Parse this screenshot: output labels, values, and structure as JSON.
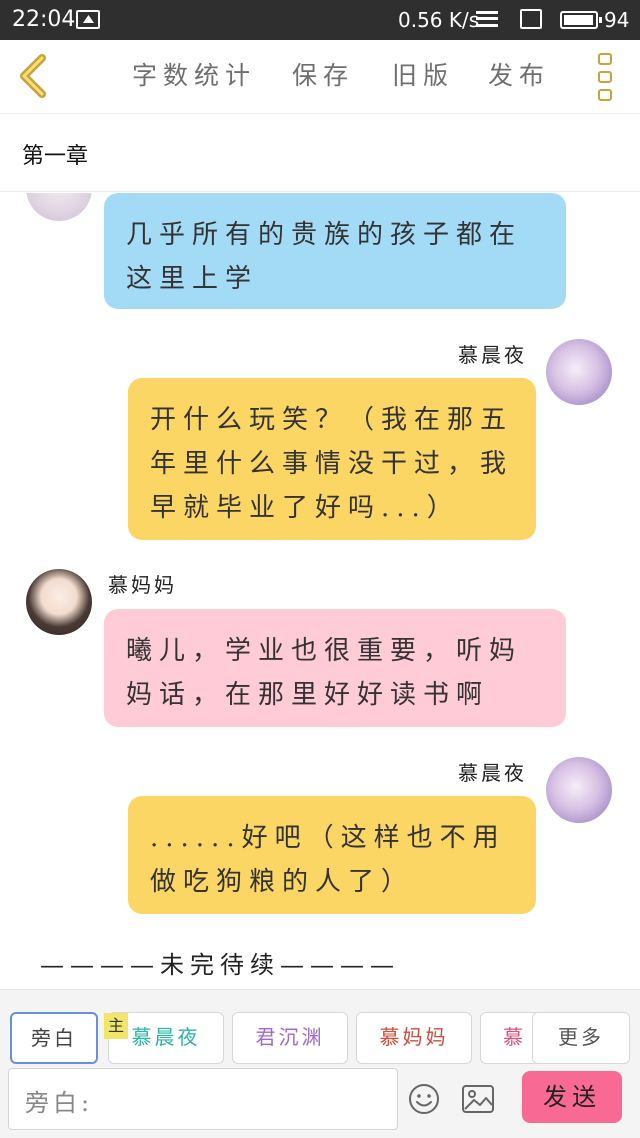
{
  "status_bar": {
    "time": "22:04",
    "network_speed": "0.56 K/s",
    "battery": "94"
  },
  "toolbar": {
    "word_count": "字数统计",
    "save": "保存",
    "old_version": "旧版",
    "publish": "发布"
  },
  "chapter": {
    "title": "第一章"
  },
  "messages": [
    {
      "speaker": "",
      "text": "几乎所有的贵族的孩子都在这里上学",
      "color": "#a3dbf7"
    },
    {
      "speaker": "慕晨夜",
      "text": "开什么玩笑？（我在那五年里什么事情没干过，我早就毕业了好吗...）",
      "color": "#fbd665"
    },
    {
      "speaker": "慕妈妈",
      "text": "曦儿，学业也很重要，听妈妈话，在那里好好读书啊",
      "color": "#fecbd6"
    },
    {
      "speaker": "慕晨夜",
      "text": "......好吧（这样也不用做吃狗粮的人了）",
      "color": "#fbd665"
    }
  ],
  "end_text": "————未完待续————",
  "characters": {
    "narration": "旁白",
    "main_tag": "主",
    "c1": {
      "name": "慕晨夜",
      "color": "#2bb5a3"
    },
    "c2": {
      "name": "君沉渊",
      "color": "#a06ad0"
    },
    "c3": {
      "name": "慕妈妈",
      "color": "#d04b3a"
    },
    "c4": {
      "name": "慕",
      "color": "#e0507a"
    },
    "more": "更多"
  },
  "input": {
    "placeholder": "旁白:"
  },
  "send_label": "发送",
  "accent_colors": {
    "send": "#f86a94",
    "back": "#c9a43c"
  }
}
